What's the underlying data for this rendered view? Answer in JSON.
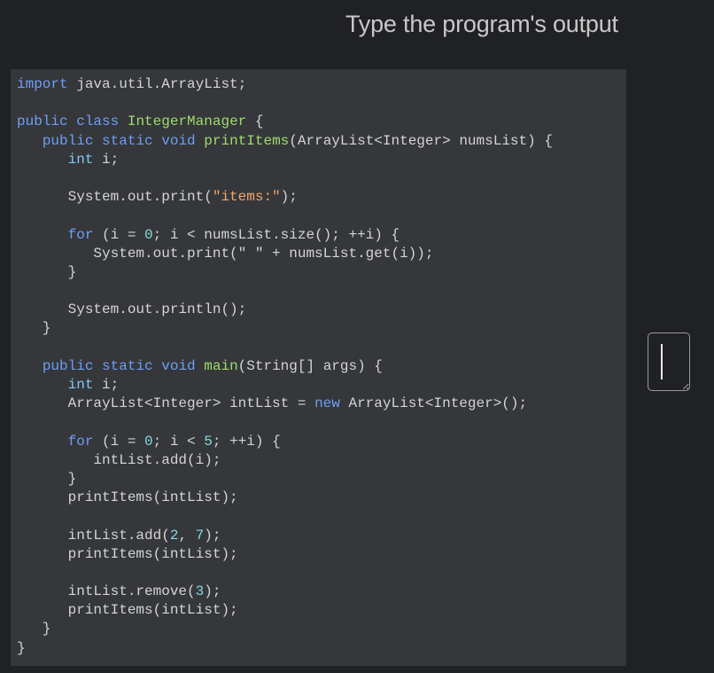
{
  "prompt": {
    "title": "Type the program's output"
  },
  "code": {
    "lines": [
      [
        {
          "t": "kw",
          "v": "import"
        },
        {
          "t": "plain",
          "v": " java.util.ArrayList;"
        }
      ],
      [],
      [
        {
          "t": "kw",
          "v": "public"
        },
        {
          "t": "plain",
          "v": " "
        },
        {
          "t": "kw",
          "v": "class"
        },
        {
          "t": "plain",
          "v": " "
        },
        {
          "t": "class",
          "v": "IntegerManager"
        },
        {
          "t": "plain",
          "v": " {"
        }
      ],
      [
        {
          "t": "plain",
          "v": "   "
        },
        {
          "t": "kw",
          "v": "public"
        },
        {
          "t": "plain",
          "v": " "
        },
        {
          "t": "kw",
          "v": "static"
        },
        {
          "t": "plain",
          "v": " "
        },
        {
          "t": "kw",
          "v": "void"
        },
        {
          "t": "plain",
          "v": " "
        },
        {
          "t": "fn",
          "v": "printItems"
        },
        {
          "t": "plain",
          "v": "(ArrayList<Integer> numsList) {"
        }
      ],
      [
        {
          "t": "plain",
          "v": "      "
        },
        {
          "t": "type",
          "v": "int"
        },
        {
          "t": "plain",
          "v": " i;"
        }
      ],
      [],
      [
        {
          "t": "plain",
          "v": "      System.out.print("
        },
        {
          "t": "str",
          "v": "\"items:\""
        },
        {
          "t": "plain",
          "v": ");"
        }
      ],
      [],
      [
        {
          "t": "plain",
          "v": "      "
        },
        {
          "t": "kw",
          "v": "for"
        },
        {
          "t": "plain",
          "v": " (i = "
        },
        {
          "t": "num",
          "v": "0"
        },
        {
          "t": "plain",
          "v": "; i < numsList.size(); ++i) {"
        }
      ],
      [
        {
          "t": "plain",
          "v": "         System.out.print(\" \" + numsList.get(i));"
        }
      ],
      [
        {
          "t": "plain",
          "v": "      }"
        }
      ],
      [],
      [
        {
          "t": "plain",
          "v": "      System.out.println();"
        }
      ],
      [
        {
          "t": "plain",
          "v": "   }"
        }
      ],
      [],
      [
        {
          "t": "plain",
          "v": "   "
        },
        {
          "t": "kw",
          "v": "public"
        },
        {
          "t": "plain",
          "v": " "
        },
        {
          "t": "kw",
          "v": "static"
        },
        {
          "t": "plain",
          "v": " "
        },
        {
          "t": "kw",
          "v": "void"
        },
        {
          "t": "plain",
          "v": " "
        },
        {
          "t": "fn",
          "v": "main"
        },
        {
          "t": "plain",
          "v": "(String[] args) {"
        }
      ],
      [
        {
          "t": "plain",
          "v": "      "
        },
        {
          "t": "type",
          "v": "int"
        },
        {
          "t": "plain",
          "v": " i;"
        }
      ],
      [
        {
          "t": "plain",
          "v": "      ArrayList<Integer> intList = "
        },
        {
          "t": "kw",
          "v": "new"
        },
        {
          "t": "plain",
          "v": " ArrayList<Integer>();"
        }
      ],
      [],
      [
        {
          "t": "plain",
          "v": "      "
        },
        {
          "t": "kw",
          "v": "for"
        },
        {
          "t": "plain",
          "v": " (i = "
        },
        {
          "t": "num",
          "v": "0"
        },
        {
          "t": "plain",
          "v": "; i < "
        },
        {
          "t": "num",
          "v": "5"
        },
        {
          "t": "plain",
          "v": "; ++i) {"
        }
      ],
      [
        {
          "t": "plain",
          "v": "         intList.add(i);"
        }
      ],
      [
        {
          "t": "plain",
          "v": "      }"
        }
      ],
      [
        {
          "t": "plain",
          "v": "      printItems(intList);"
        }
      ],
      [],
      [
        {
          "t": "plain",
          "v": "      intList.add("
        },
        {
          "t": "num",
          "v": "2"
        },
        {
          "t": "plain",
          "v": ", "
        },
        {
          "t": "num",
          "v": "7"
        },
        {
          "t": "plain",
          "v": ");"
        }
      ],
      [
        {
          "t": "plain",
          "v": "      printItems(intList);"
        }
      ],
      [],
      [
        {
          "t": "plain",
          "v": "      intList.remove("
        },
        {
          "t": "num",
          "v": "3"
        },
        {
          "t": "plain",
          "v": ");"
        }
      ],
      [
        {
          "t": "plain",
          "v": "      printItems(intList);"
        }
      ],
      [
        {
          "t": "plain",
          "v": "   }"
        }
      ],
      [
        {
          "t": "plain",
          "v": "}"
        }
      ]
    ]
  },
  "answer": {
    "value": ""
  },
  "colors": {
    "background": "#202124",
    "panel": "#35373a",
    "keyword": "#6f9ef8",
    "type": "#83c7f3",
    "function": "#9fdc6c",
    "string": "#f2a66b",
    "number": "#83dbe0",
    "text": "#d4d4d4"
  }
}
